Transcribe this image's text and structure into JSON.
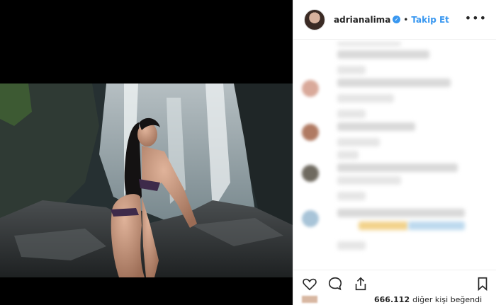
{
  "header": {
    "username": "adrianalima",
    "separator": "•",
    "follow_label": "Takip Et",
    "more_label": "•••"
  },
  "icons": [
    "heart-icon",
    "comment-icon",
    "share-icon",
    "bookmark-icon",
    "verified-icon"
  ],
  "colors": {
    "accent": "#3897f0",
    "text": "#262626",
    "border": "#efefef"
  },
  "likes": {
    "count": "666.112",
    "text": "diğer kişi beğendi"
  }
}
